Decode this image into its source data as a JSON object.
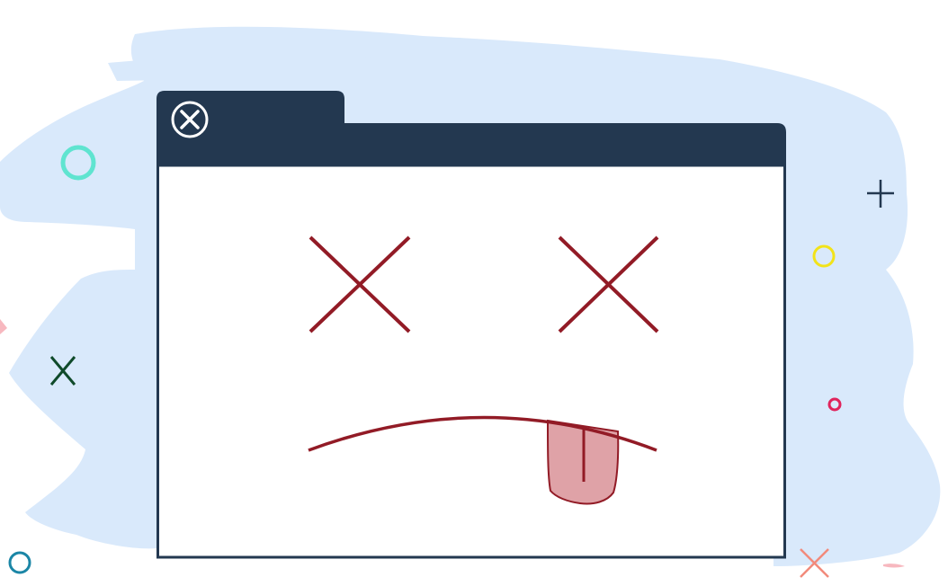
{
  "colors": {
    "page_background": "#ffffff",
    "blob": "#d9e9fb",
    "window_frame": "#233850",
    "window_body": "#ffffff",
    "close_icon": "#ffffff",
    "face": "#921b26",
    "tongue_fill": "#dfa2a7",
    "deco_teal_ring": "#5fe4d0",
    "deco_navy_plus": "#233850",
    "deco_yellow_ring": "#f2e31a",
    "deco_pink_ring": "#e0245c",
    "deco_green_x": "#0f4a2a",
    "deco_blue_ring": "#1b86a6",
    "deco_salmon_x": "#f28a7b",
    "deco_pink_dash": "#f7b8bf"
  },
  "icons": {
    "close": "close-circle-icon"
  },
  "illustration": {
    "subject": "error-window-sad-face",
    "eyes": "x-eyes",
    "mouth": "frown-with-tongue"
  }
}
